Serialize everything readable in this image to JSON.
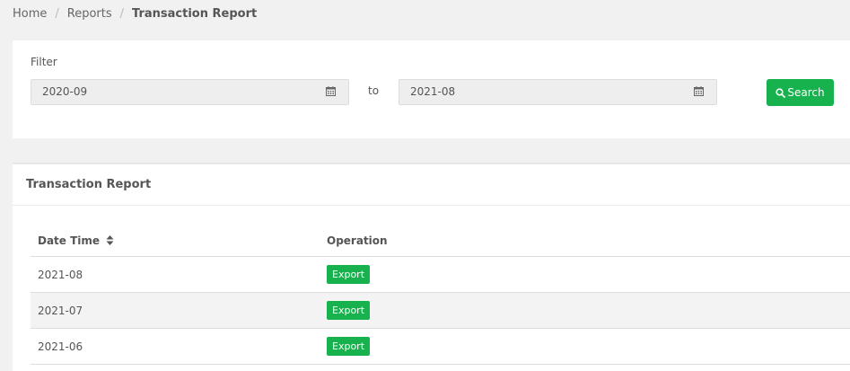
{
  "breadcrumb": {
    "items": [
      "Home",
      "Reports"
    ],
    "current": "Transaction Report"
  },
  "filter": {
    "label": "Filter",
    "from_value": "2020-09",
    "to_label": "to",
    "to_value": "2021-08",
    "search_label": "Search",
    "accent_color": "#17b14e"
  },
  "report": {
    "title": "Transaction Report",
    "columns": [
      "Date Time",
      "Operation"
    ],
    "rows": [
      {
        "date": "2021-08",
        "action": "Export"
      },
      {
        "date": "2021-07",
        "action": "Export"
      },
      {
        "date": "2021-06",
        "action": "Export"
      }
    ]
  }
}
